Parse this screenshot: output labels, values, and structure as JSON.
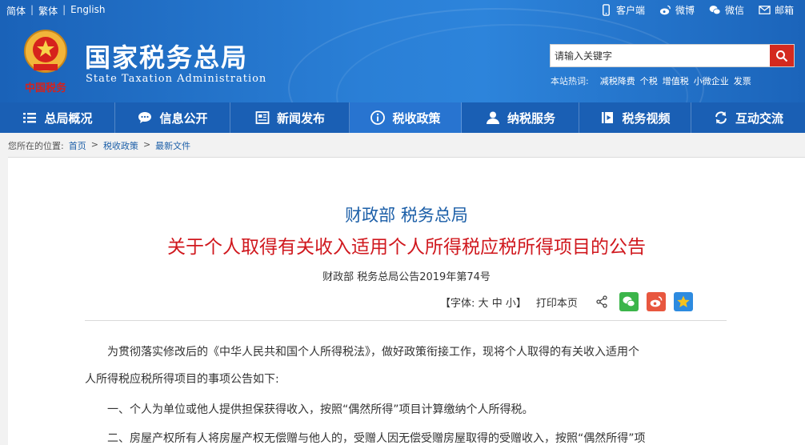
{
  "lang": {
    "simplified": "简体",
    "traditional": "繁体",
    "english": "English",
    "sep": "|"
  },
  "toplinks": [
    {
      "label": "客户端",
      "icon": "mobile-icon"
    },
    {
      "label": "微博",
      "icon": "weibo-icon"
    },
    {
      "label": "微信",
      "icon": "wechat-icon"
    },
    {
      "label": "邮箱",
      "icon": "mail-icon"
    }
  ],
  "site": {
    "title": "国家税务总局",
    "subtitle": "State Taxation Administration"
  },
  "search": {
    "placeholder": "请输入关键字"
  },
  "hot": {
    "label": "本站热词:",
    "words": [
      "减税降费",
      "个税",
      "增值税",
      "小微企业",
      "发票"
    ]
  },
  "nav": [
    {
      "label": "总局概况",
      "icon": "menu-icon",
      "active": false
    },
    {
      "label": "信息公开",
      "icon": "chat-icon",
      "active": false
    },
    {
      "label": "新闻发布",
      "icon": "newspaper-icon",
      "active": false
    },
    {
      "label": "税收政策",
      "icon": "info-icon",
      "active": true
    },
    {
      "label": "纳税服务",
      "icon": "user-icon",
      "active": false
    },
    {
      "label": "税务视频",
      "icon": "video-icon",
      "active": false
    },
    {
      "label": "互动交流",
      "icon": "refresh-icon",
      "active": false
    }
  ],
  "breadcrumb": {
    "prefix": "您所在的位置:",
    "items": [
      "首页",
      "税收政策",
      "最新文件"
    ],
    "sep": ">"
  },
  "article": {
    "issuer": "财政部 税务总局",
    "title": "关于个人取得有关收入适用个人所得税应税所得项目的公告",
    "doc_no": "财政部 税务总局公告2019年第74号",
    "tools": {
      "font_label": "【字体:",
      "font_big": "大",
      "font_mid": "中",
      "font_small": "小】",
      "print": "打印本页"
    },
    "paragraphs": [
      "为贯彻落实修改后的《中华人民共和国个人所得税法》，做好政策衔接工作，现将个人取得的有关收入适用个",
      "人所得税应税所得项目的事项公告如下:",
      "一、个人为单位或他人提供担保获得收入，按照“偶然所得”项目计算缴纳个人所得税。",
      "二、房屋产权所有人将房屋产权无偿赠与他人的，受赠人因无偿受赠房屋取得的受赠收入，按照“偶然所得”项"
    ]
  },
  "colors": {
    "header": "#1f6fc5",
    "nav": "#1a5fb4",
    "nav_active": "#2874d0",
    "title_red": "#d0181e",
    "issuer_blue": "#1c5fa8",
    "search_btn": "#d42a1f"
  }
}
